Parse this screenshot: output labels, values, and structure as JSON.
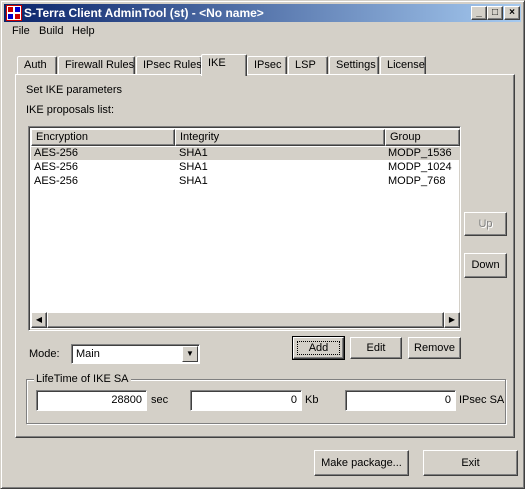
{
  "window": {
    "title": "S-Terra Client AdminTool (st) - <No name>",
    "minimize": "_",
    "maximize": "□",
    "close": "×"
  },
  "menu": [
    "File",
    "Build",
    "Help"
  ],
  "tabs": [
    "Auth",
    "Firewall Rules",
    "IPsec Rules",
    "IKE",
    "IPsec",
    "LSP",
    "Settings",
    "License"
  ],
  "active_tab": "IKE",
  "panel": {
    "heading": "Set IKE parameters",
    "list_label": "IKE proposals list:",
    "columns": [
      "Encryption",
      "Integrity",
      "Group"
    ],
    "rows": [
      {
        "encryption": "AES-256",
        "integrity": "SHA1",
        "group": "MODP_1536",
        "selected": true
      },
      {
        "encryption": "AES-256",
        "integrity": "SHA1",
        "group": "MODP_1024"
      },
      {
        "encryption": "AES-256",
        "integrity": "SHA1",
        "group": "MODP_768"
      }
    ],
    "up_button": "Up",
    "down_button": "Down",
    "mode_label": "Mode:",
    "mode_value": "Main",
    "add_button": "Add",
    "edit_button": "Edit",
    "remove_button": "Remove",
    "lifetime": {
      "legend": "LifeTime of IKE SA",
      "seconds": "28800",
      "seconds_unit": "sec",
      "kilobytes": "0",
      "kilobytes_unit": "Kb",
      "ipsec_sa": "0",
      "ipsec_sa_unit": "IPsec SA"
    }
  },
  "footer": {
    "make_package": "Make package...",
    "exit": "Exit"
  },
  "colors": {
    "title_start": "#0a246a",
    "title_end": "#a6caf0",
    "face": "#d4d0c8"
  }
}
